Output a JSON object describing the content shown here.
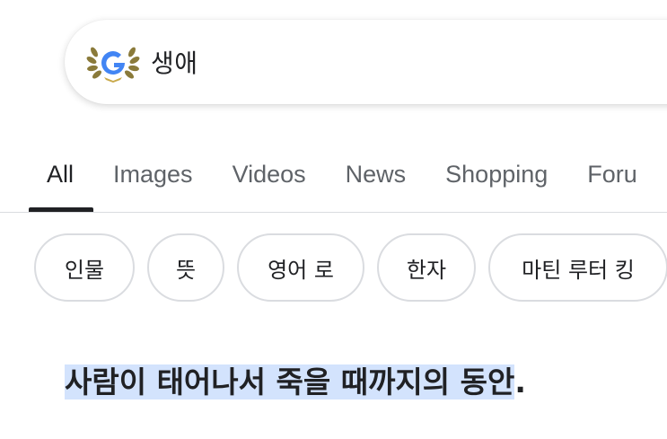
{
  "search": {
    "query": "생애",
    "logo_icon": "google-doodle-laurel-icon"
  },
  "tabs": [
    {
      "label": "All",
      "active": true
    },
    {
      "label": "Images",
      "active": false
    },
    {
      "label": "Videos",
      "active": false
    },
    {
      "label": "News",
      "active": false
    },
    {
      "label": "Shopping",
      "active": false
    },
    {
      "label": "Foru",
      "active": false
    }
  ],
  "chips": [
    {
      "label": "인물"
    },
    {
      "label": "뜻"
    },
    {
      "label": "영어 로"
    },
    {
      "label": "한자"
    },
    {
      "label": "마틴 루터 킹"
    }
  ],
  "result": {
    "highlighted_text": "사람이 태어나서 죽을 때까지의 동안",
    "trailing_text": "."
  },
  "colors": {
    "active_tab": "#202124",
    "inactive_tab": "#5f6368",
    "highlight": "#d3e3fd",
    "chip_border": "#dadce0"
  }
}
